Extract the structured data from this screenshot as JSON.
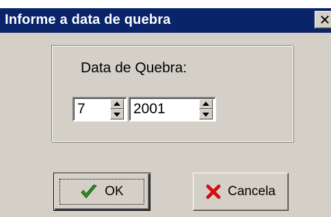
{
  "window": {
    "title": "Informe a data de quebra",
    "close_glyph": "✕"
  },
  "group": {
    "label": "Data de Quebra:"
  },
  "month_spinner": {
    "value": "7"
  },
  "year_spinner": {
    "value": "2001"
  },
  "buttons": {
    "ok_label": "OK",
    "ok_icon": "checkmark-icon",
    "cancel_label": "Cancela",
    "cancel_icon": "red-x-icon"
  },
  "colors": {
    "titlebar": "#0a246a",
    "face": "#d4d0c8",
    "check_green": "#2e8b22",
    "cancel_red": "#d01010"
  }
}
